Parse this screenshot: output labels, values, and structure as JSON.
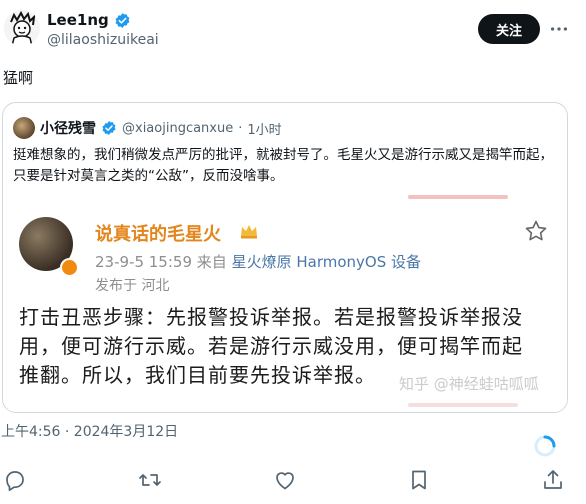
{
  "header": {
    "display_name": "Lee1ng",
    "handle": "@lilaoshizuikeai",
    "follow_label": "关注"
  },
  "post": {
    "text": "猛啊",
    "timestamp": "上午4:56 · 2024年3月12日"
  },
  "quote": {
    "name": "小径残雪",
    "handle": "@xiaojingcanxue",
    "separator": "·",
    "time": "1小时",
    "text": "挺难想象的，我们稍微发点严厉的批评，就被封号了。毛星火又是游行示威又是揭竿而起，只要是针对莫言之类的“公敌”，反而没啥事。",
    "weibo": {
      "name": "说真话的毛星火",
      "date": "23-9-5 15:59",
      "source_prefix": "来自",
      "source": "星火燎原 HarmonyOS 设备",
      "location": "发布于 河北",
      "body": "打击丑恶步骤：先报警投诉举报。若是报警投诉举报没用，便可游行示威。若是游行示威没用，便可揭竿而起推翻。所以，我们目前要先投诉举报。",
      "watermark": "知乎 @神经蛙咕呱呱"
    }
  },
  "colors": {
    "follow_bg": "#0f1419",
    "verified": "#1d9bf0",
    "weibo_name": "#e2861d"
  }
}
